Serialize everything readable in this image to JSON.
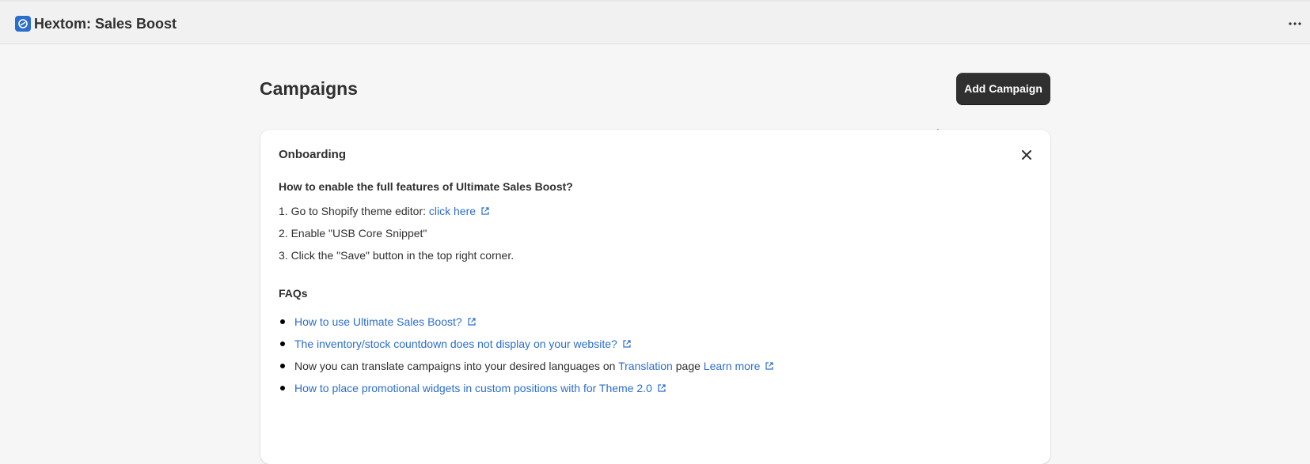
{
  "app": {
    "title": "Hextom: Sales Boost",
    "logo_icon": "app-logo-icon",
    "brand_color": "#2c6ecb"
  },
  "page": {
    "title": "Campaigns",
    "primary_action": "Add Campaign"
  },
  "onboarding": {
    "title": "Onboarding",
    "question": "How to enable the full features of Ultimate Sales Boost?",
    "steps": [
      {
        "text": "1. Go to Shopify theme editor: ",
        "link": "click here"
      },
      {
        "text": "2. Enable \"USB Core Snippet\""
      },
      {
        "text": "3. Click the \"Save\" button in the top right corner."
      }
    ],
    "faq_heading": "FAQs",
    "faqs": [
      {
        "link": "How to use Ultimate Sales Boost?"
      },
      {
        "link": "The inventory/stock countdown does not display on your website?"
      },
      {
        "text_before": "Now you can translate campaigns into your desired languages on ",
        "link_mid": "Translation",
        "text_mid": " page ",
        "link": "Learn more"
      },
      {
        "link": "How to place promotional widgets in custom positions with for Theme 2.0"
      }
    ]
  },
  "colors": {
    "link": "#2c6ecb",
    "button_bg": "#303030",
    "annotation_arrow": "#e81010"
  }
}
